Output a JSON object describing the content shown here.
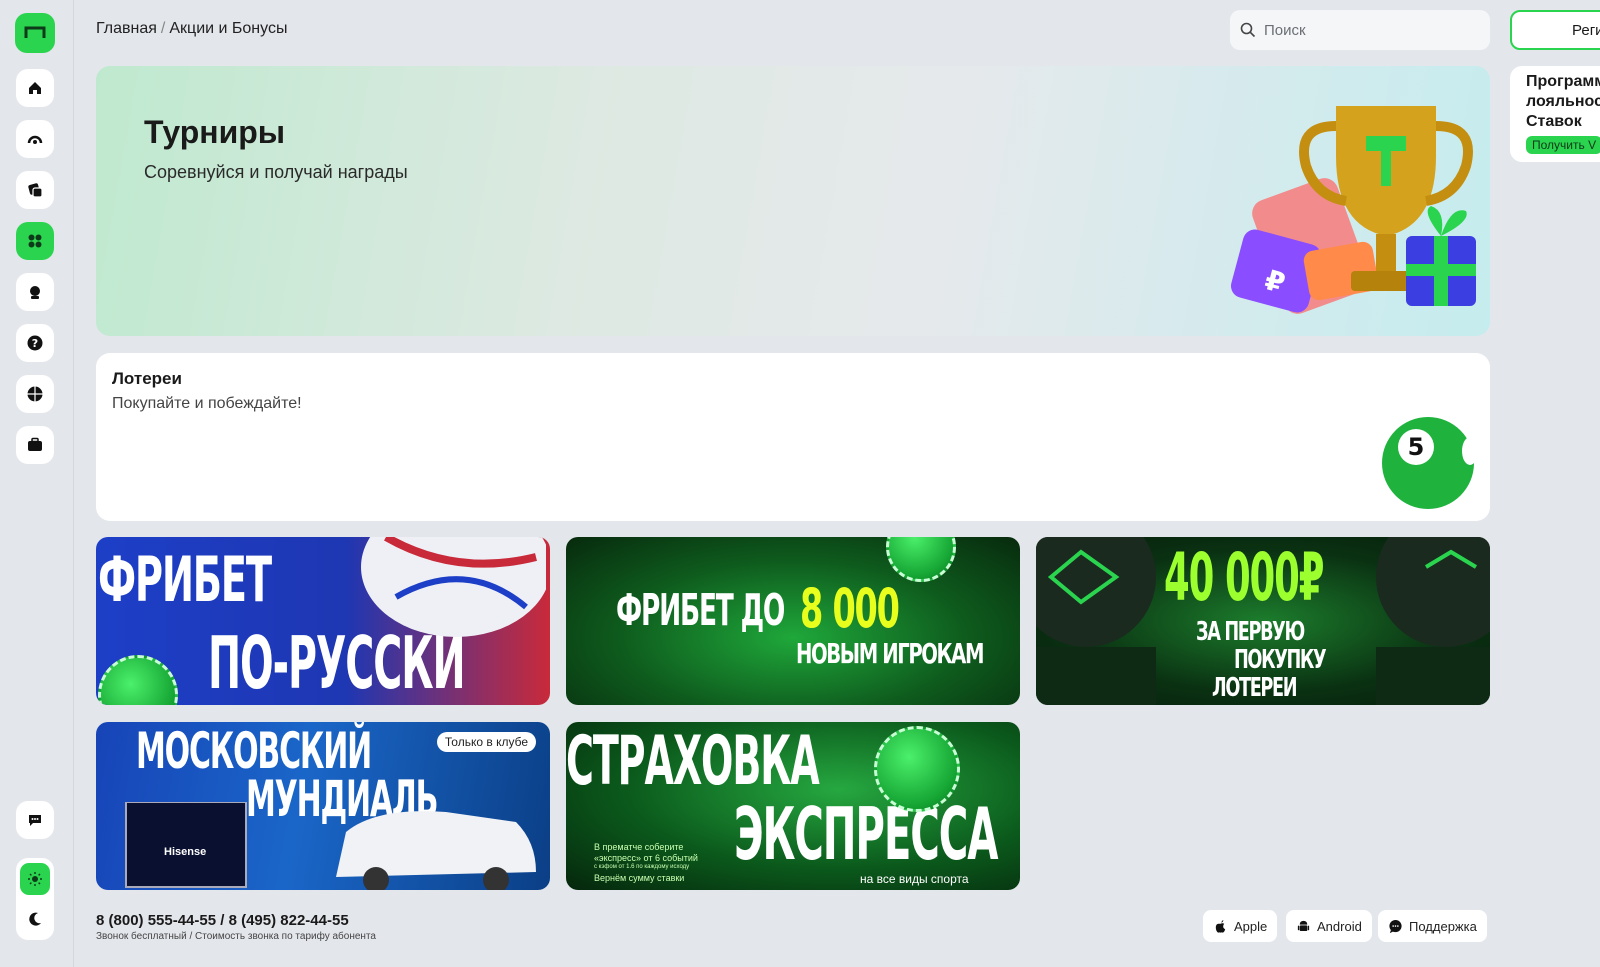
{
  "breadcrumb": {
    "home": "Главная",
    "separator": "/",
    "current": "Акции и Бонусы"
  },
  "search": {
    "placeholder": "Поиск"
  },
  "header": {
    "register_label": "Реги"
  },
  "loyalty": {
    "title_line1": "Программ",
    "title_line2": "лояльност",
    "title_line3": "Ставок",
    "button": "Получить V"
  },
  "tournaments": {
    "title": "Турниры",
    "subtitle": "Соревнуйся и получай награды"
  },
  "lottery": {
    "title": "Лотереи",
    "subtitle": "Покупайте и побеждайте!",
    "ball_number": "5"
  },
  "promos": [
    {
      "line1": "ФРИБЕТ",
      "line2": "ПО-РУССКИ"
    },
    {
      "line1": "ФРИБЕТ ДО",
      "amount": "8 000",
      "line2": "НОВЫМ ИГРОКАМ"
    },
    {
      "amount": "40 000₽",
      "line1": "ЗА ПЕРВУЮ",
      "line2": "ПОКУПКУ",
      "line3": "ЛОТЕРЕИ"
    },
    {
      "line1": "МОСКОВСКИЙ",
      "line2": "МУНДИАЛЬ",
      "badge": "Только в клубе",
      "brand": "Hisense"
    },
    {
      "line1": "СТРАХОВКА",
      "line2": "ЭКСПРЕССА",
      "note1": "В прематче соберите",
      "note2": "«экспресс» от 6 событий",
      "note3": "с кэфом от 1.6 по каждому исходу",
      "note4": "Вернём сумму ставки",
      "footer": "на все виды спорта"
    }
  ],
  "footer": {
    "phones": "8 (800) 555-44-55 / 8 (495) 822-44-55",
    "phone_note": "Звонок бесплатный / Стоимость звонка по тарифу абонента",
    "apple": "Apple",
    "android": "Android",
    "support": "Поддержка"
  },
  "colors": {
    "accent": "#2bd44e",
    "background": "#e3e6eb",
    "card": "#ffffff"
  }
}
